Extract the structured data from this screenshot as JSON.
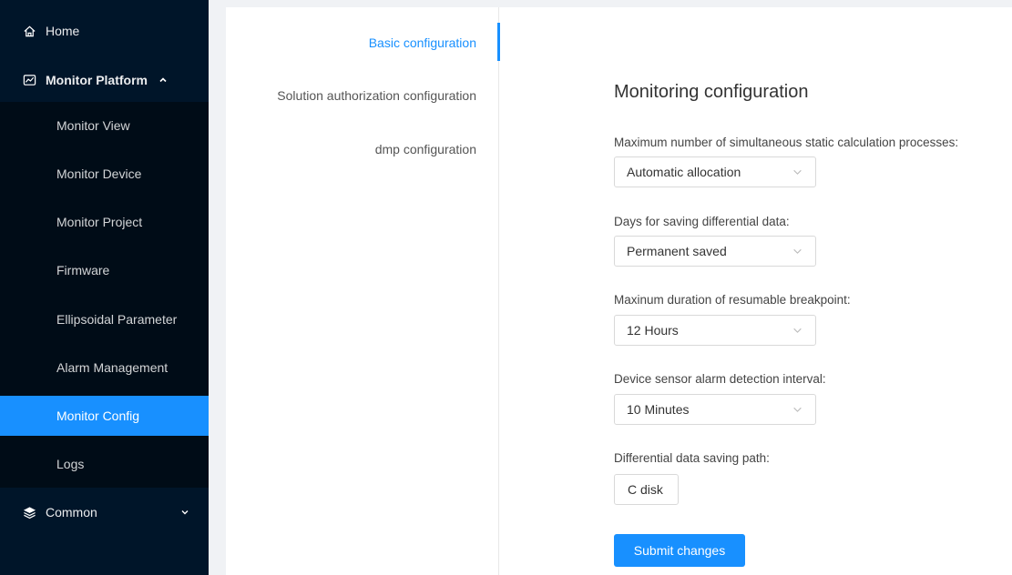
{
  "sidebar": {
    "home": {
      "label": "Home",
      "icon": "home-icon"
    },
    "monitor_platform": {
      "label": "Monitor Platform",
      "icon": "monitor-chart-icon",
      "expanded": true
    },
    "sub_items": [
      {
        "label": "Monitor View"
      },
      {
        "label": "Monitor Device"
      },
      {
        "label": "Monitor Project"
      },
      {
        "label": "Firmware"
      },
      {
        "label": "Ellipsoidal Parameter"
      },
      {
        "label": "Alarm Management"
      },
      {
        "label": "Monitor Config",
        "active": true
      },
      {
        "label": "Logs"
      }
    ],
    "common": {
      "label": "Common",
      "icon": "layers-icon",
      "expanded": false
    }
  },
  "tabs": [
    {
      "label": "Basic configuration",
      "active": true
    },
    {
      "label": "Solution authorization configuration"
    },
    {
      "label": "dmp configuration"
    }
  ],
  "form": {
    "title": "Monitoring configuration",
    "fields": [
      {
        "label": "Maximum number of simultaneous static calculation processes:",
        "value": "Automatic allocation"
      },
      {
        "label": "Days for saving differential data:",
        "value": "Permanent saved"
      },
      {
        "label": "Maxinum duration of resumable breakpoint:",
        "value": "12 Hours"
      },
      {
        "label": "Device sensor alarm detection interval:",
        "value": "10 Minutes"
      },
      {
        "label": "Differential data saving path:",
        "value": "C disk"
      }
    ],
    "submit_label": "Submit changes"
  },
  "colors": {
    "sidebar_bg": "#001529",
    "submenu_bg": "#000c17",
    "accent": "#1890ff"
  }
}
